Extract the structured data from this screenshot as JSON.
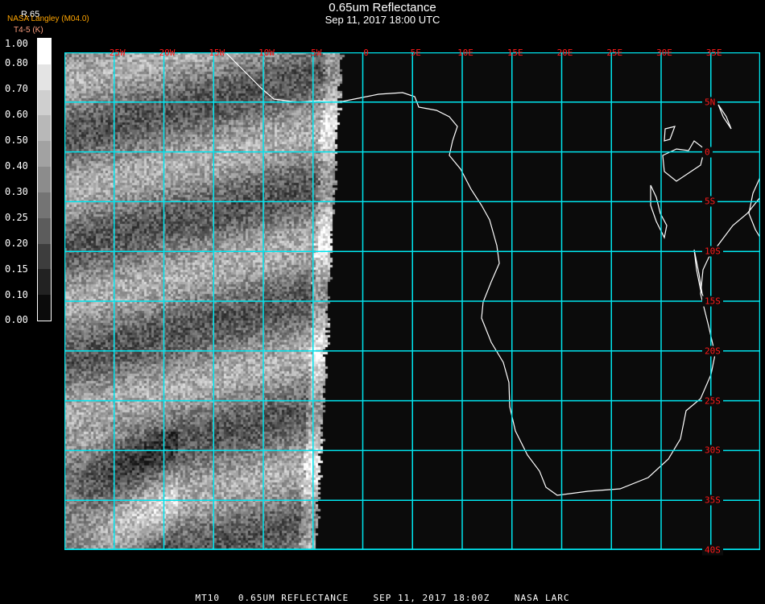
{
  "header": {
    "title": "0.65um Reflectance",
    "subtitle": "Sep 11, 2017 18:00 UTC",
    "org": "NASA Langley (M04.0)",
    "channel": "R.65",
    "unit": "T4-5 (K)"
  },
  "colorbar": {
    "labels": [
      "1.00",
      "0.80",
      "0.70",
      "0.60",
      "0.50",
      "0.40",
      "0.30",
      "0.25",
      "0.20",
      "0.15",
      "0.10",
      "0.00"
    ],
    "colors": [
      "#ffffff",
      "#e4e4e4",
      "#cfcfcf",
      "#b8b8b8",
      "#a2a2a2",
      "#8c8c8c",
      "#747474",
      "#5c5c5c",
      "#3d3d3d",
      "#222222",
      "#0b0b0b"
    ]
  },
  "map": {
    "grid_color": "#00e5ee",
    "label_color": "#ff1a1a",
    "lon_labels": [
      "25W",
      "20W",
      "15W",
      "10W",
      "5W",
      "0",
      "5E",
      "10E",
      "15E",
      "20E",
      "25E",
      "30E",
      "35E"
    ],
    "lat_labels": [
      "5N",
      "0",
      "5S",
      "10S",
      "15S",
      "20S",
      "25S",
      "30S",
      "35S",
      "40S"
    ]
  },
  "footer": "MT10   0.65UM REFLECTANCE    SEP 11, 2017 18:00Z    NASA LARC"
}
